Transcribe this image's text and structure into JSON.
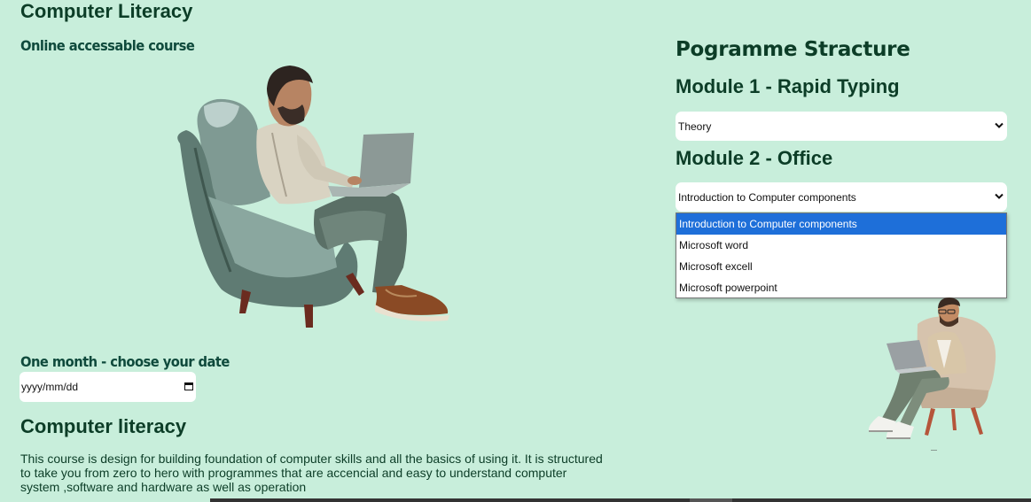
{
  "header": {
    "title": "Computer Literacy"
  },
  "left": {
    "subtitle": "Online accessable course",
    "duration_label": "One month - choose your date",
    "date_input": {
      "placeholder": "yyyy/mm/dd",
      "icon": "calendar-icon"
    },
    "section_heading": "Computer literacy",
    "description": "This course is design for building foundation of computer skills and all the basics of using it. It is structured to take you from zero to hero with programmes that are accencial and easy to understand computer system ,software and hardware as well as operation"
  },
  "right": {
    "programme_title": "Pogramme Stracture",
    "module1": {
      "title": "Module 1 - Rapid Typing",
      "selected": "Theory"
    },
    "module2": {
      "title": "Module 2 - Office",
      "selected": "Introduction to Computer components",
      "options": [
        "Introduction to Computer components",
        "Microsoft word",
        "Microsoft excell",
        "Microsoft powerpoint"
      ]
    }
  },
  "colors": {
    "background": "#c8eedb",
    "heading": "#0c3d27",
    "highlight": "#1e6fd9"
  }
}
